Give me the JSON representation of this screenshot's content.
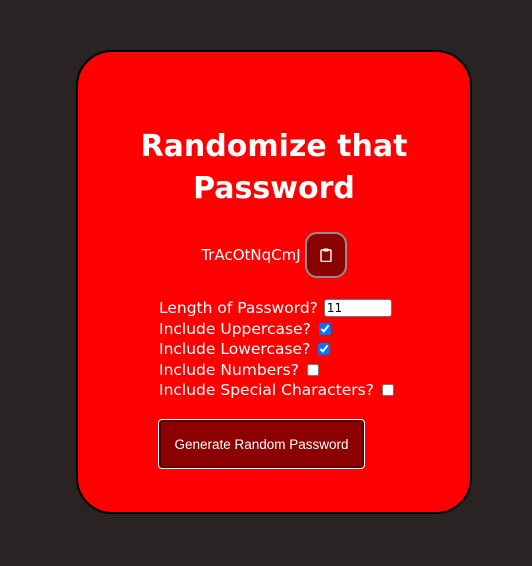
{
  "title": "Randomize that Password",
  "password": "TrAcOtNqCmJ",
  "copy_icon": "clipboard-icon",
  "options": {
    "length_label": "Length of Password?",
    "length_value": "11",
    "uppercase_label": "Include Uppercase?",
    "uppercase_checked": true,
    "lowercase_label": "Include Lowercase?",
    "lowercase_checked": true,
    "numbers_label": "Include Numbers?",
    "numbers_checked": false,
    "special_label": "Include Special Characters?",
    "special_checked": false
  },
  "generate_label": "Generate Random Password",
  "colors": {
    "background": "#292423",
    "card": "#ff0000",
    "button": "#8b0000",
    "text": "#ffffff"
  }
}
